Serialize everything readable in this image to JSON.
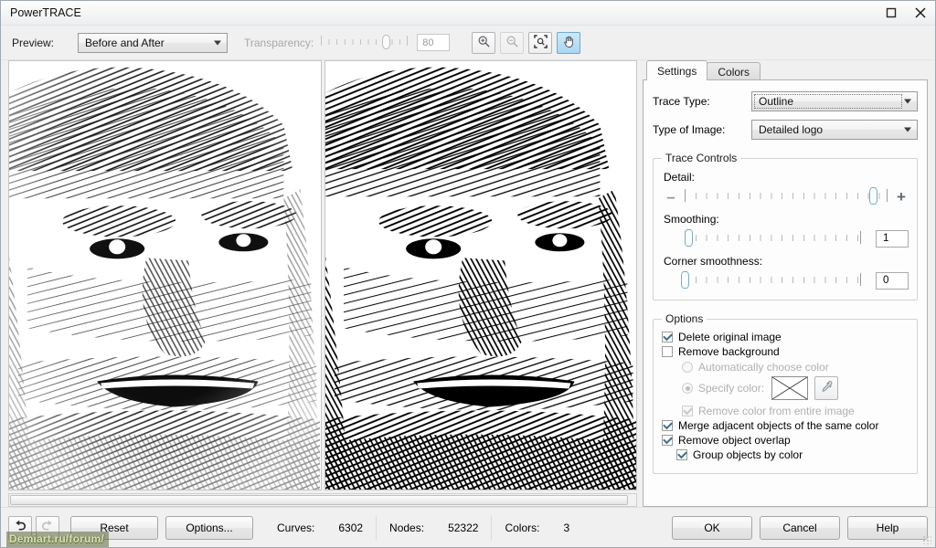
{
  "window": {
    "title": "PowerTRACE",
    "maximize_icon": "maximize-icon",
    "close_icon": "close-icon"
  },
  "toolbar": {
    "preview_label": "Preview:",
    "preview_value": "Before and After",
    "transparency_label": "Transparency:",
    "transparency_value": "80",
    "transparency_percent": 80,
    "buttons": [
      {
        "name": "zoom-in-button",
        "icon": "zoom-in-icon",
        "active": false,
        "enabled": true
      },
      {
        "name": "zoom-out-button",
        "icon": "zoom-out-icon",
        "active": false,
        "enabled": false
      },
      {
        "name": "fit-to-window-button",
        "icon": "fit-to-window-icon",
        "active": false,
        "enabled": true
      },
      {
        "name": "pan-tool-button",
        "icon": "hand-icon",
        "active": true,
        "enabled": true
      }
    ]
  },
  "preview": {
    "left_pane_name": "original-image-preview",
    "right_pane_name": "traced-result-preview",
    "scrollbar_name": "preview-horizontal-scrollbar"
  },
  "settings": {
    "tabs": [
      {
        "label": "Settings",
        "active": true
      },
      {
        "label": "Colors",
        "active": false
      }
    ],
    "trace_type_label": "Trace Type:",
    "trace_type_value": "Outline",
    "image_type_label": "Type of Image:",
    "image_type_value": "Detailed logo",
    "trace_controls": {
      "legend": "Trace Controls",
      "detail_label": "Detail:",
      "detail_percent": 93,
      "minus_glyph": "–",
      "plus_glyph": "+",
      "smoothing_label": "Smoothing:",
      "smoothing_value": "1",
      "smoothing_percent": 2,
      "corner_label": "Corner smoothness:",
      "corner_value": "0",
      "corner_percent": 0
    },
    "options": {
      "legend": "Options",
      "delete_original": {
        "label": "Delete original image",
        "checked": true,
        "enabled": true
      },
      "remove_background": {
        "label": "Remove background",
        "checked": false,
        "enabled": true
      },
      "auto_color": {
        "label": "Automatically choose color",
        "selected": false,
        "enabled": false
      },
      "specify_color": {
        "label": "Specify color:",
        "selected": true,
        "enabled": false
      },
      "color_swatch_name": "no-color-swatch",
      "eyedropper_label": "eyedropper-icon",
      "remove_entire": {
        "label": "Remove color from entire image",
        "checked": true,
        "enabled": false
      },
      "merge_adjacent": {
        "label": "Merge adjacent objects of the same color",
        "checked": true,
        "enabled": true
      },
      "remove_overlap": {
        "label": "Remove object overlap",
        "checked": true,
        "enabled": true
      },
      "group_by_color": {
        "label": "Group objects by color",
        "checked": true,
        "enabled": true
      }
    }
  },
  "statusbar": {
    "undo_icon": "undo-icon",
    "redo_icon": "redo-icon",
    "reset_label": "Reset",
    "options_label": "Options...",
    "stats": [
      {
        "key": "Curves:",
        "value": "6302"
      },
      {
        "key": "Nodes:",
        "value": "52322"
      },
      {
        "key": "Colors:",
        "value": "3"
      }
    ],
    "ok_label": "OK",
    "cancel_label": "Cancel",
    "help_label": "Help"
  },
  "watermark": {
    "text": "Demiart.ru/forum/"
  },
  "colors": {
    "accent": "#a9d7f2",
    "panel": "#f0f0f0",
    "panel_light": "#fdfdfd",
    "border": "#b2b2b2",
    "text": "#1a1a1a",
    "disabled_text": "#b0b0b0",
    "watermark": "#d9dfae"
  }
}
